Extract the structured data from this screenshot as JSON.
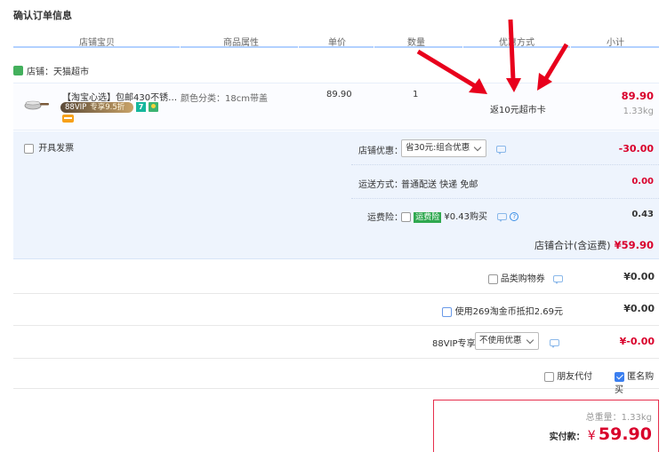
{
  "page": {
    "title": "确认订单信息"
  },
  "columns": [
    "店铺宝贝",
    "商品属性",
    "单价",
    "数量",
    "优惠方式",
    "小计"
  ],
  "shop": {
    "label": "店铺：天猫超市"
  },
  "item": {
    "title": "【淘宝心选】包邮430不锈钢雪...",
    "vip_badge": "88VIP",
    "vip_discount": "专享9.5折",
    "icon7": "7",
    "attribute": "颜色分类：18cm带盖",
    "unit_price": "89.90",
    "quantity": "1",
    "promo": "返10元超市卡",
    "subtotal": "89.90",
    "weight": "1.33kg"
  },
  "invoice": {
    "label": "开具发票",
    "checked": false
  },
  "shop_discount": {
    "label": "店铺优惠：",
    "selected": "省30元:组合优惠",
    "amount": "-30.00"
  },
  "shipping": {
    "label": "运送方式：",
    "value": "普通配送 快递 免邮",
    "amount": "0.00"
  },
  "insurance": {
    "label": "运费险：",
    "tag": "运费险",
    "price_text": "¥0.43购买",
    "amount": "0.43",
    "help": "?"
  },
  "shop_total": {
    "label": "店铺合计(含运费)",
    "amount": "¥59.90"
  },
  "category_coupon": {
    "label": "品类购物券",
    "amount": "¥0.00"
  },
  "taobao_coin": {
    "label": "使用269淘金币抵扣2.69元",
    "amount": "¥0.00"
  },
  "vip88": {
    "label": "88VIP专享",
    "selected": "不使用优惠",
    "amount": "¥-0.00"
  },
  "friend_pay": {
    "label": "朋友代付",
    "checked": false
  },
  "anonymous": {
    "label": "匿名购买",
    "checked": true
  },
  "summary": {
    "weight_label": "总重量：",
    "weight": "1.33kg",
    "pay_label": "实付款：",
    "currency": "¥",
    "pay_amount": "59.90"
  },
  "colors": {
    "accent_red": "#d9002b",
    "header_line": "#b2d1ff",
    "arrow": "#e8001c"
  }
}
